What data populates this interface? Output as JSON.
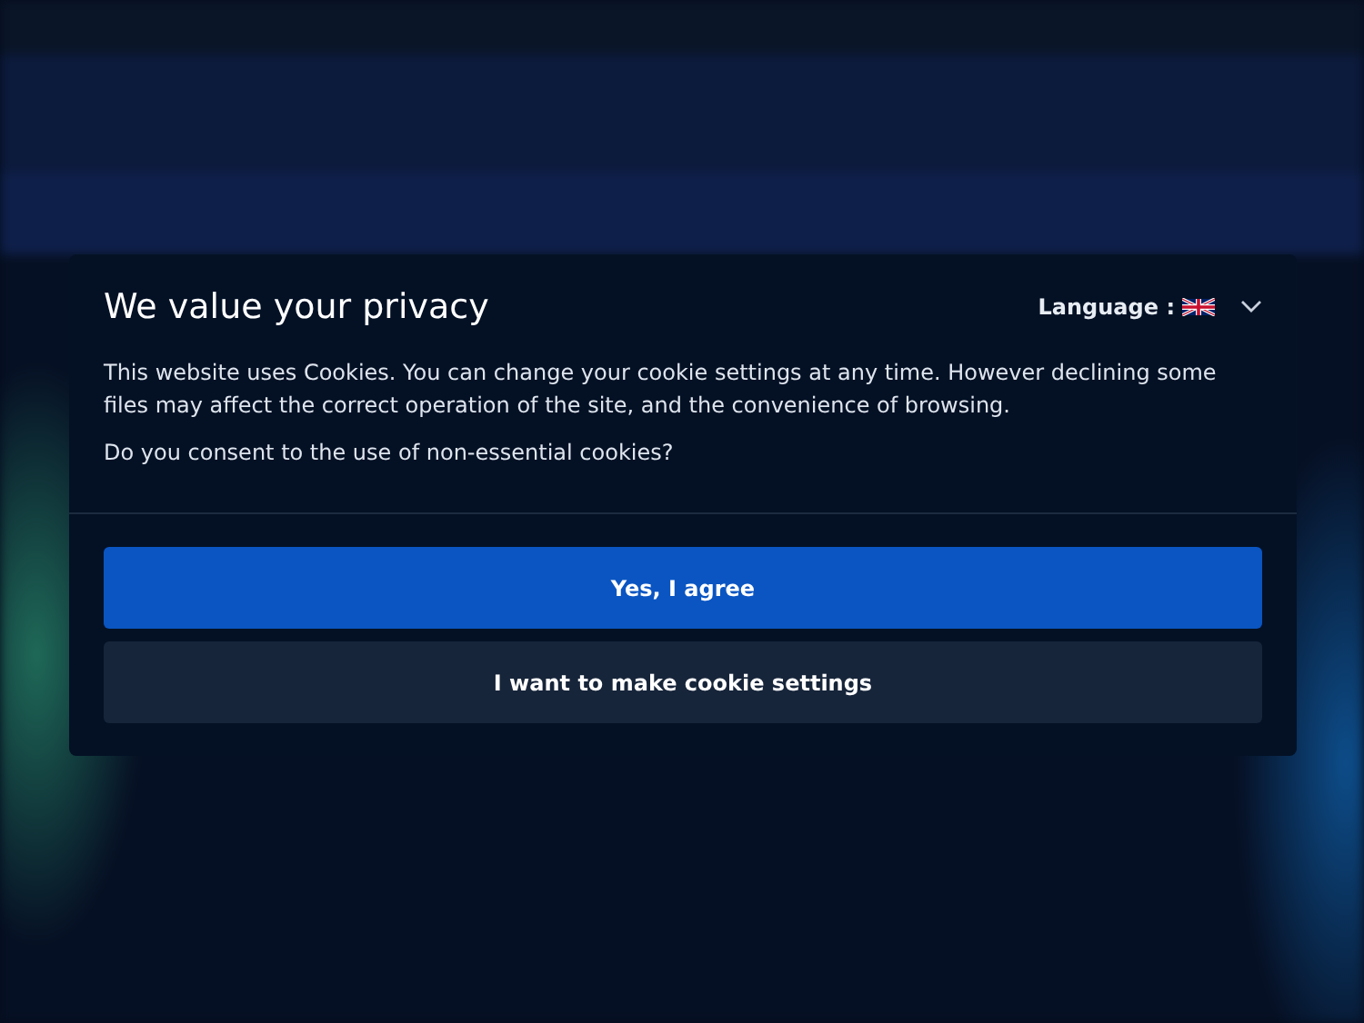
{
  "dialog": {
    "title": "We value your privacy",
    "language": {
      "label": "Language :",
      "expanded": false
    },
    "paragraphs": [
      "This website uses Cookies. You can change your cookie settings at any time. However declining some files may affect the correct operation of the site, and the convenience of browsing.",
      "Do you consent to the use of non-essential cookies?"
    ],
    "buttons": [
      {
        "label": "Yes, I agree",
        "kind": "primary"
      },
      {
        "label": "I want to make cookie settings",
        "kind": "secondary"
      }
    ]
  }
}
